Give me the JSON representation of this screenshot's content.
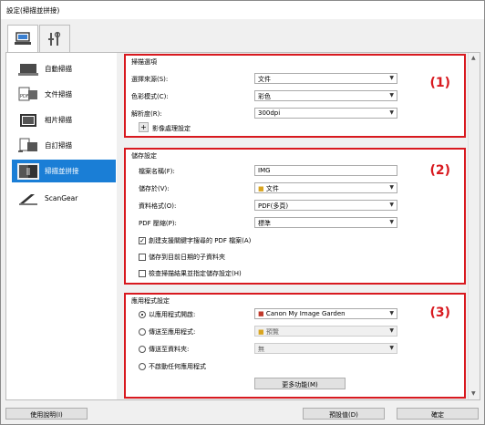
{
  "window": {
    "title": "設定(掃描並拼接)"
  },
  "tabs": [
    {
      "name": "scan-tab",
      "icon": "scanner-computer-icon"
    },
    {
      "name": "general-settings-tab",
      "icon": "tools-icon"
    }
  ],
  "sidebar": {
    "items": [
      {
        "label": "自動掃描",
        "icon": "auto-scan-icon"
      },
      {
        "label": "文件掃描",
        "icon": "document-scan-icon"
      },
      {
        "label": "相片掃描",
        "icon": "photo-scan-icon"
      },
      {
        "label": "自訂掃描",
        "icon": "custom-scan-icon"
      },
      {
        "label": "掃描並拼接",
        "icon": "stitch-scan-icon"
      },
      {
        "label": "ScanGear",
        "icon": "scangear-icon"
      }
    ]
  },
  "scan_options": {
    "title": "掃描選項",
    "number": "(1)",
    "source_label": "選擇來源(S):",
    "source_value": "文件",
    "color_label": "色彩模式(C):",
    "color_value": "彩色",
    "resolution_label": "解析度(R):",
    "resolution_value": "300dpi",
    "image_processing_label": "影像處理設定"
  },
  "save_settings": {
    "title": "儲存設定",
    "number": "(2)",
    "filename_label": "檔案名稱(F):",
    "filename_value": "IMG",
    "save_in_label": "儲存於(V):",
    "save_in_value": "文件",
    "format_label": "資料格式(O):",
    "format_value": "PDF(多頁)",
    "compression_label": "PDF 壓縮(P):",
    "compression_value": "標準",
    "check1": "創建支援關鍵字搜尋的 PDF 檔案(A)",
    "check2": "儲存到目前日期的子資料夾",
    "check3": "檢查掃描結果並指定儲存設定(H)"
  },
  "app_settings": {
    "title": "應用程式設定",
    "number": "(3)",
    "radio1": "以應用程式開啟:",
    "radio1_value": "Canon My Image Garden",
    "radio2": "傳送至應用程式:",
    "radio2_value": "預覽",
    "radio3": "傳送至資料夾:",
    "radio3_value": "無",
    "radio4": "不啟動任何應用程式",
    "more_button": "更多功能(M)"
  },
  "footer": {
    "help_button": "使用說明(I)",
    "defaults_button": "預設值(D)",
    "ok_button": "確定"
  }
}
